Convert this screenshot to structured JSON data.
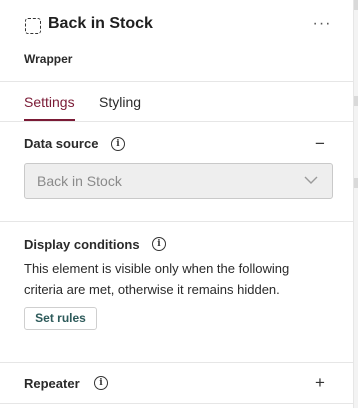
{
  "header": {
    "title": "Back in Stock",
    "subtitle": "Wrapper",
    "more_label": "···"
  },
  "tabs": [
    {
      "label": "Settings",
      "active": true
    },
    {
      "label": "Styling",
      "active": false
    }
  ],
  "data_source": {
    "title": "Data source",
    "toggle": "−",
    "select_value": "Back in Stock"
  },
  "display_conditions": {
    "title": "Display conditions",
    "description": "This element is visible only when the following criteria are met, otherwise it remains hidden.",
    "button_label": "Set rules"
  },
  "repeater": {
    "title": "Repeater",
    "toggle": "+"
  },
  "colors": {
    "accent": "#7a1a35",
    "button_text": "#2d5a5a"
  },
  "icons": {
    "header": "dashed-selection-icon",
    "menu": "more-horizontal-icon",
    "info": "info-icon",
    "select": "chevron-down-icon"
  }
}
